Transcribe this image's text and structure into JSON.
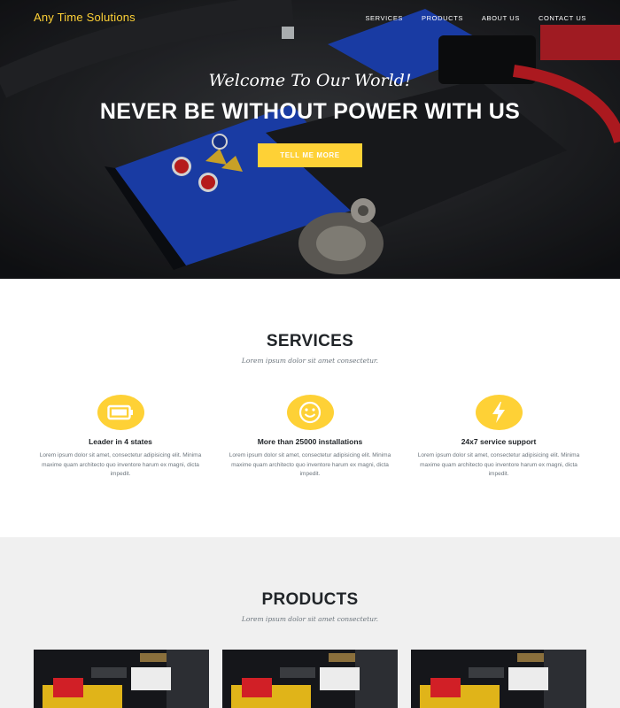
{
  "brand": "Any Time Solutions",
  "nav": [
    "SERVICES",
    "PRODUCTS",
    "ABOUT US",
    "CONTACT US"
  ],
  "hero": {
    "subtitle": "Welcome To Our World!",
    "title": "NEVER BE WITHOUT POWER WITH US",
    "button": "TELL ME MORE"
  },
  "services": {
    "title": "SERVICES",
    "subtitle": "Lorem ipsum dolor sit amet consectetur.",
    "items": [
      {
        "icon": "battery-icon",
        "title": "Leader in 4 states",
        "text": "Lorem ipsum dolor sit amet, consectetur adipisicing elit. Minima maxime quam architecto quo inventore harum ex magni, dicta impedit."
      },
      {
        "icon": "smiley-icon",
        "title": "More than 25000 installations",
        "text": "Lorem ipsum dolor sit amet, consectetur adipisicing elit. Minima maxime quam architecto quo inventore harum ex magni, dicta impedit."
      },
      {
        "icon": "bolt-icon",
        "title": "24x7 service support",
        "text": "Lorem ipsum dolor sit amet, consectetur adipisicing elit. Minima maxime quam architecto quo inventore harum ex magni, dicta impedit."
      }
    ]
  },
  "products": {
    "title": "PRODUCTS",
    "subtitle": "Lorem ipsum dolor sit amet consectetur."
  },
  "colors": {
    "accent": "#fed136",
    "dark": "#212529",
    "muted": "#6c757d",
    "section_gray": "#f0f0f0"
  }
}
